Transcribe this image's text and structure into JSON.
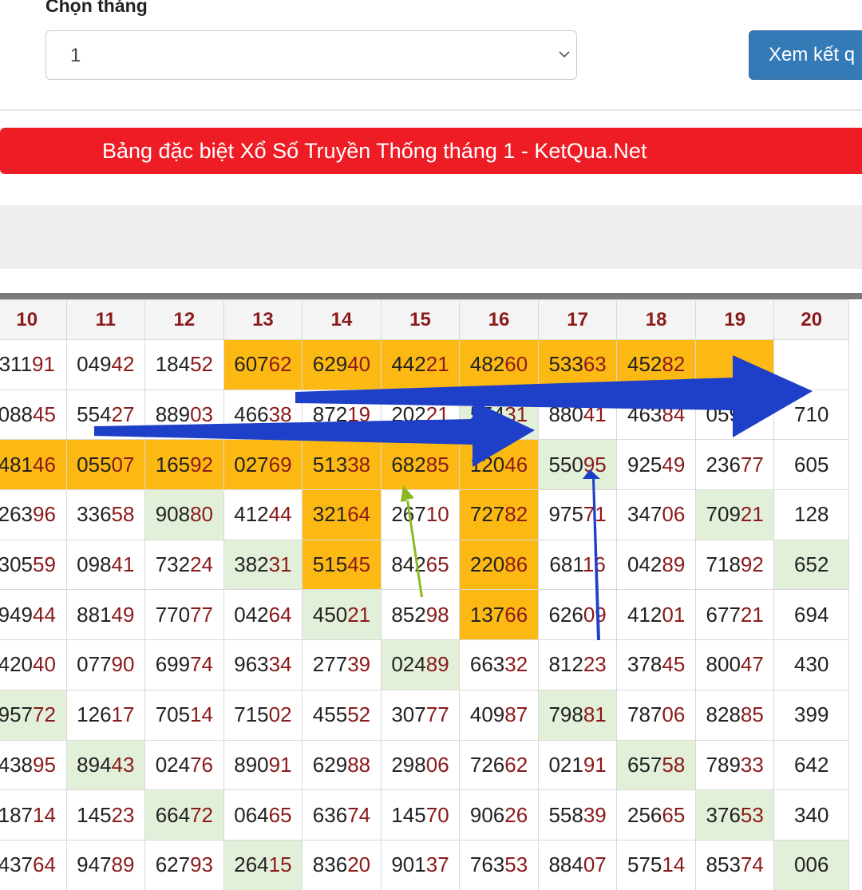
{
  "form": {
    "label": "Chọn tháng",
    "select_value": "1",
    "submit_label": "Xem kết q"
  },
  "banner": {
    "title": "Bảng đặc biệt Xổ Số Truyền Thống tháng 1 - KetQua.Net"
  },
  "table": {
    "headers": [
      "10",
      "11",
      "12",
      "13",
      "14",
      "15",
      "16",
      "17",
      "18",
      "19",
      "20"
    ],
    "rows": [
      [
        [
          "311",
          "91",
          ""
        ],
        [
          "049",
          "42",
          ""
        ],
        [
          "184",
          "52",
          ""
        ],
        [
          "607",
          "62",
          "o"
        ],
        [
          "629",
          "40",
          "o"
        ],
        [
          "442",
          "21",
          "o"
        ],
        [
          "482",
          "60",
          "o"
        ],
        [
          "533",
          "63",
          "o"
        ],
        [
          "452",
          "82",
          "o"
        ],
        [
          "",
          "",
          "o"
        ],
        [
          "",
          "",
          ""
        ]
      ],
      [
        [
          "088",
          "45",
          ""
        ],
        [
          "554",
          "27",
          ""
        ],
        [
          "889",
          "03",
          ""
        ],
        [
          "466",
          "38",
          ""
        ],
        [
          "872",
          "19",
          ""
        ],
        [
          "202",
          "21",
          ""
        ],
        [
          "554",
          "31",
          "g"
        ],
        [
          "880",
          "41",
          ""
        ],
        [
          "463",
          "84",
          ""
        ],
        [
          "059",
          "30",
          ""
        ],
        [
          "710",
          "",
          ""
        ]
      ],
      [
        [
          "481",
          "46",
          "o"
        ],
        [
          "055",
          "07",
          "o"
        ],
        [
          "165",
          "92",
          "o"
        ],
        [
          "027",
          "69",
          "o"
        ],
        [
          "513",
          "38",
          "o"
        ],
        [
          "682",
          "85",
          "o"
        ],
        [
          "120",
          "46",
          "o"
        ],
        [
          "550",
          "95",
          "g"
        ],
        [
          "925",
          "49",
          ""
        ],
        [
          "236",
          "77",
          ""
        ],
        [
          "605",
          "",
          ""
        ]
      ],
      [
        [
          "263",
          "96",
          ""
        ],
        [
          "336",
          "58",
          ""
        ],
        [
          "908",
          "80",
          "g"
        ],
        [
          "412",
          "44",
          ""
        ],
        [
          "321",
          "64",
          "o"
        ],
        [
          "267",
          "10",
          ""
        ],
        [
          "727",
          "82",
          "o"
        ],
        [
          "975",
          "71",
          ""
        ],
        [
          "347",
          "06",
          ""
        ],
        [
          "709",
          "21",
          "g"
        ],
        [
          "128",
          "",
          ""
        ]
      ],
      [
        [
          "305",
          "59",
          ""
        ],
        [
          "098",
          "41",
          ""
        ],
        [
          "732",
          "24",
          ""
        ],
        [
          "382",
          "31",
          "g"
        ],
        [
          "515",
          "45",
          "o"
        ],
        [
          "842",
          "65",
          ""
        ],
        [
          "220",
          "86",
          "o"
        ],
        [
          "681",
          "16",
          ""
        ],
        [
          "042",
          "89",
          ""
        ],
        [
          "718",
          "92",
          ""
        ],
        [
          "652",
          "",
          "g"
        ]
      ],
      [
        [
          "949",
          "44",
          ""
        ],
        [
          "881",
          "49",
          ""
        ],
        [
          "770",
          "77",
          ""
        ],
        [
          "042",
          "64",
          ""
        ],
        [
          "450",
          "21",
          "g"
        ],
        [
          "852",
          "98",
          ""
        ],
        [
          "137",
          "66",
          "o"
        ],
        [
          "626",
          "09",
          ""
        ],
        [
          "412",
          "01",
          ""
        ],
        [
          "677",
          "21",
          ""
        ],
        [
          "694",
          "",
          ""
        ]
      ],
      [
        [
          "420",
          "40",
          ""
        ],
        [
          "077",
          "90",
          ""
        ],
        [
          "699",
          "74",
          ""
        ],
        [
          "963",
          "34",
          ""
        ],
        [
          "277",
          "39",
          ""
        ],
        [
          "024",
          "89",
          "g"
        ],
        [
          "663",
          "32",
          ""
        ],
        [
          "812",
          "23",
          ""
        ],
        [
          "378",
          "45",
          ""
        ],
        [
          "800",
          "47",
          ""
        ],
        [
          "430",
          "",
          ""
        ]
      ],
      [
        [
          "957",
          "72",
          "g"
        ],
        [
          "126",
          "17",
          ""
        ],
        [
          "705",
          "14",
          ""
        ],
        [
          "715",
          "02",
          ""
        ],
        [
          "455",
          "52",
          ""
        ],
        [
          "307",
          "77",
          ""
        ],
        [
          "409",
          "87",
          ""
        ],
        [
          "798",
          "81",
          "g"
        ],
        [
          "787",
          "06",
          ""
        ],
        [
          "828",
          "85",
          ""
        ],
        [
          "399",
          "",
          ""
        ]
      ],
      [
        [
          "438",
          "95",
          ""
        ],
        [
          "894",
          "43",
          "g"
        ],
        [
          "024",
          "76",
          ""
        ],
        [
          "890",
          "91",
          ""
        ],
        [
          "629",
          "88",
          ""
        ],
        [
          "298",
          "06",
          ""
        ],
        [
          "726",
          "62",
          ""
        ],
        [
          "021",
          "91",
          ""
        ],
        [
          "657",
          "58",
          "g"
        ],
        [
          "789",
          "33",
          ""
        ],
        [
          "642",
          "",
          ""
        ]
      ],
      [
        [
          "187",
          "14",
          ""
        ],
        [
          "145",
          "23",
          ""
        ],
        [
          "664",
          "72",
          "g"
        ],
        [
          "064",
          "65",
          ""
        ],
        [
          "636",
          "74",
          ""
        ],
        [
          "145",
          "70",
          ""
        ],
        [
          "906",
          "26",
          ""
        ],
        [
          "558",
          "39",
          ""
        ],
        [
          "256",
          "65",
          ""
        ],
        [
          "376",
          "53",
          "g"
        ],
        [
          "340",
          "",
          ""
        ]
      ],
      [
        [
          "437",
          "64",
          ""
        ],
        [
          "947",
          "89",
          ""
        ],
        [
          "627",
          "93",
          ""
        ],
        [
          "264",
          "15",
          "g"
        ],
        [
          "836",
          "20",
          ""
        ],
        [
          "901",
          "37",
          ""
        ],
        [
          "763",
          "53",
          ""
        ],
        [
          "884",
          "07",
          ""
        ],
        [
          "575",
          "14",
          ""
        ],
        [
          "853",
          "74",
          ""
        ],
        [
          "006",
          "",
          "g"
        ]
      ]
    ]
  },
  "colors": {
    "banner": "#ee1c25",
    "button": "#337ab7",
    "highlight_orange": "#fdb913",
    "highlight_green": "#e3f0d9",
    "tail_digits": "#8b1a1a",
    "arrow_blue": "#1e3fc8",
    "arrow_green": "#8ab81e"
  },
  "icons": {
    "select_caret": "chevron-down-icon"
  }
}
